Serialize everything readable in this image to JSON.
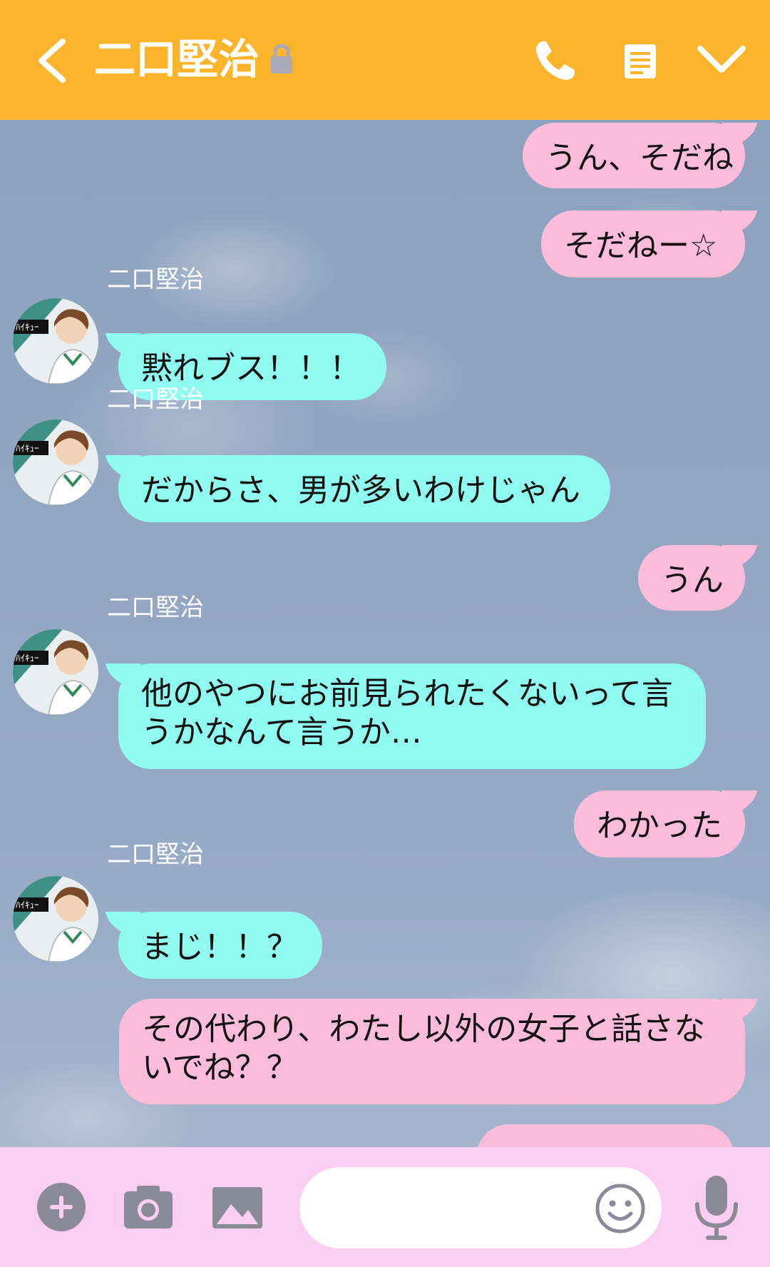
{
  "header": {
    "title": "二口堅治",
    "background": "#FDB42A"
  },
  "contact": {
    "name": "二口堅治"
  },
  "messages": [
    {
      "from": "me",
      "text": "うん、そだね"
    },
    {
      "from": "me",
      "text": "そだねー☆"
    },
    {
      "from": "them",
      "text": "黙れブス！！！"
    },
    {
      "from": "them",
      "text": "だからさ、男が多いわけじゃん"
    },
    {
      "from": "me",
      "text": "うん"
    },
    {
      "from": "them",
      "text": "他のやつにお前見られたくないって言うかなんて言うか…"
    },
    {
      "from": "me",
      "text": "わかった"
    },
    {
      "from": "them",
      "text": "まじ！！？"
    },
    {
      "from": "me",
      "text": "その代わり、わたし以外の女子と話さないでね？？"
    }
  ],
  "colors": {
    "my_bubble": "#FDBCD9",
    "their_bubble": "#8FFBF1",
    "input_bar": "#FCCEF3",
    "icon": "#8A8A99"
  },
  "icons": {
    "back": "chevron-left-icon",
    "lock": "lock-icon",
    "call": "phone-icon",
    "notes": "notes-icon",
    "collapse": "chevron-down-icon",
    "plus": "plus-icon",
    "camera": "camera-icon",
    "gallery": "image-icon",
    "emoji": "smiley-icon",
    "mic": "microphone-icon"
  },
  "input": {
    "placeholder": ""
  }
}
